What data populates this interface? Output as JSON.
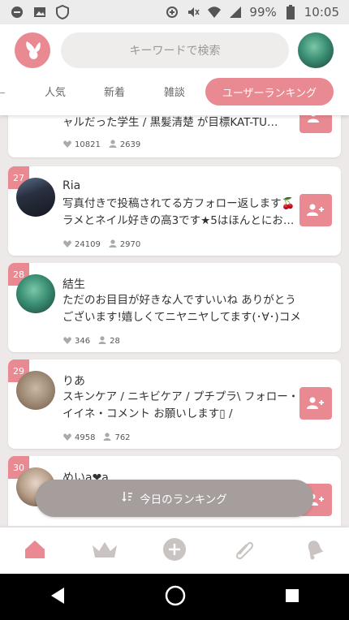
{
  "status_bar": {
    "battery": "99%",
    "time": "10:05"
  },
  "header": {
    "search_placeholder": "キーワードで検索",
    "tabs": [
      {
        "label": "人気"
      },
      {
        "label": "新着"
      },
      {
        "label": "雑談"
      },
      {
        "label": "ユーザーランキング"
      }
    ]
  },
  "colors": {
    "accent": "#e98a93",
    "background": "#ece9e8",
    "floating_button": "#a59e9d"
  },
  "users": [
    {
      "rank": "",
      "name": "",
      "bio": "ャルだった学生 / 黒髪清楚 が目標KAT-TU…",
      "likes": "10821",
      "followers": "2639"
    },
    {
      "rank": "27",
      "name": "Ria",
      "bio": "写真付きで投稿されてる方フォロー返します🍒 ラメとネイル好きの高3です★5はほんとにお…",
      "likes": "24109",
      "followers": "2970"
    },
    {
      "rank": "28",
      "name": "結生",
      "bio": "ただのお目目が好きな人ですいいね ありがとうございます!嬉しくてニヤニヤしてます(･∀･)コメント、フォロ…",
      "likes": "346",
      "followers": "28"
    },
    {
      "rank": "29",
      "name": "りあ",
      "bio": "スキンケア / ニキビケア / プチプラ\\ フォロー・イイネ・コメント お願いします▯ /",
      "likes": "4958",
      "followers": "762"
    },
    {
      "rank": "30",
      "name": "めいa❤a",
      "bio": "",
      "likes": "",
      "followers": ""
    }
  ],
  "floating_button": {
    "label": "今日のランキング",
    "icon": "sort-icon"
  },
  "bottom_nav": [
    {
      "icon": "home-icon"
    },
    {
      "icon": "crown-icon"
    },
    {
      "icon": "plus-icon"
    },
    {
      "icon": "paperclip-icon"
    },
    {
      "icon": "bell-icon"
    }
  ]
}
